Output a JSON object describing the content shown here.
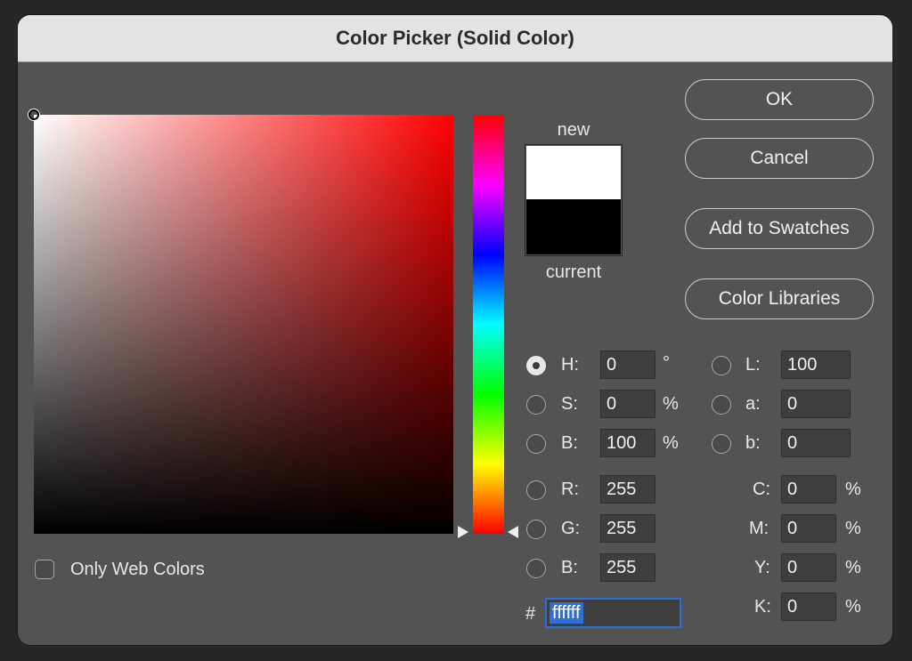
{
  "window": {
    "title": "Color Picker (Solid Color)"
  },
  "buttons": {
    "ok": "OK",
    "cancel": "Cancel",
    "add_to_swatches": "Add to Swatches",
    "color_libraries": "Color Libraries"
  },
  "swatch": {
    "new_label": "new",
    "current_label": "current",
    "new_color": "#ffffff",
    "current_color": "#000000"
  },
  "hsb": {
    "h": {
      "label": "H:",
      "value": "0",
      "unit": "°",
      "selected": true
    },
    "s": {
      "label": "S:",
      "value": "0",
      "unit": "%"
    },
    "b": {
      "label": "B:",
      "value": "100",
      "unit": "%"
    }
  },
  "lab": {
    "l": {
      "label": "L:",
      "value": "100"
    },
    "a": {
      "label": "a:",
      "value": "0"
    },
    "b": {
      "label": "b:",
      "value": "0"
    }
  },
  "rgb": {
    "r": {
      "label": "R:",
      "value": "255"
    },
    "g": {
      "label": "G:",
      "value": "255"
    },
    "b": {
      "label": "B:",
      "value": "255"
    }
  },
  "cmyk": {
    "c": {
      "label": "C:",
      "value": "0",
      "unit": "%"
    },
    "m": {
      "label": "M:",
      "value": "0",
      "unit": "%"
    },
    "y": {
      "label": "Y:",
      "value": "0",
      "unit": "%"
    },
    "k": {
      "label": "K:",
      "value": "0",
      "unit": "%"
    }
  },
  "hex": {
    "prefix": "#",
    "value": "ffffff"
  },
  "options": {
    "only_web_colors": "Only Web Colors"
  },
  "colors": {
    "hue_base": "#ff0000",
    "selection_blue": "#2f6fd1"
  }
}
